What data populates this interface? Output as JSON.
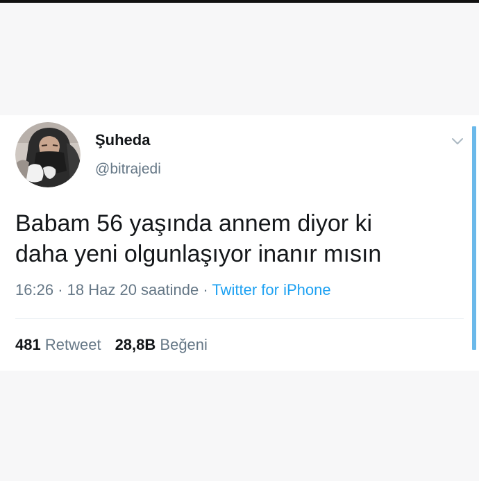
{
  "tweet": {
    "author_name": "Şuheda",
    "author_handle": "@bitrajedi",
    "text_line1": "Babam 56 yaşında annem diyor ki",
    "text_line2": "daha yeni olgunlaşıyor inanır mısın",
    "time": "16:26",
    "separator": "·",
    "date": "18 Haz 20 saatinde",
    "source": "Twitter for iPhone",
    "retweet_count": "481",
    "retweet_label": "Retweet",
    "like_count": "28,8B",
    "like_label": "Beğeni"
  },
  "icons": {
    "menu": "chevron-down-icon",
    "avatar": "avatar"
  },
  "colors": {
    "text": "#14171a",
    "secondary": "#657786",
    "link": "#1da1f2",
    "divider": "#e6ecf0",
    "scroll": "#6bb9ea"
  }
}
